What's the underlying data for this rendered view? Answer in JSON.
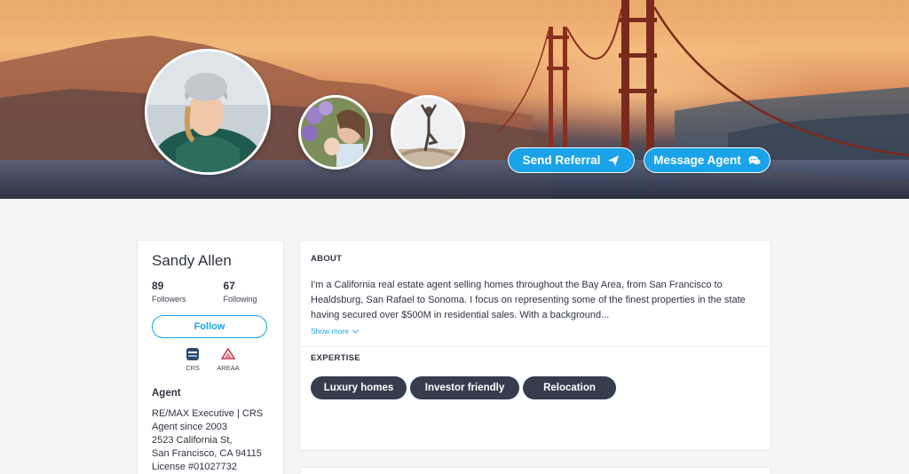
{
  "hero": {
    "send_referral_label": "Send Referral",
    "message_agent_label": "Message Agent",
    "accent": "#1aa3e8"
  },
  "profile": {
    "name": "Sandy Allen",
    "followers_count": "89",
    "followers_label": "Followers",
    "following_count": "67",
    "following_label": "Following",
    "follow_label": "Follow",
    "badges": [
      {
        "label": "CRS",
        "icon": "crs-logo-icon"
      },
      {
        "label": "AREAA",
        "icon": "areaa-logo-icon"
      }
    ],
    "agent_title": "Agent",
    "agent_lines": [
      "RE/MAX Executive | CRS",
      "Agent since 2003",
      "2523 California St,",
      "San Francisco, CA 94115",
      "License #01027732"
    ]
  },
  "about": {
    "heading": "ABOUT",
    "text": "I'm a California real estate agent selling homes throughout the Bay Area, from San Francisco to Healdsburg, San Rafael to Sonoma. I focus on representing some of the finest properties in the state having secured over $500M in residential sales. With a background...",
    "show_more_label": "Show more"
  },
  "expertise": {
    "heading": "EXPERTISE",
    "chips": [
      "Luxury homes",
      "Investor friendly",
      "Relocation"
    ],
    "chip_color": "#353d4f"
  }
}
